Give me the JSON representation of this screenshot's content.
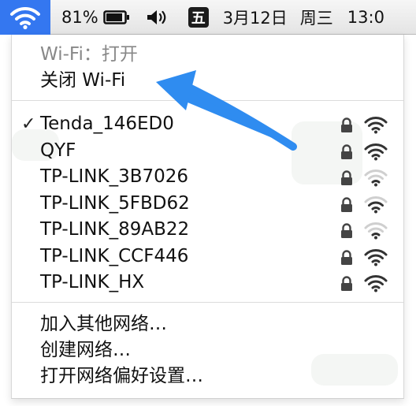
{
  "menubar": {
    "battery_percent": "81%",
    "ime_label": "五",
    "date": "3月12日",
    "weekday": "周三",
    "time": "13:0",
    "icons": [
      "wifi-icon",
      "battery-icon",
      "volume-icon",
      "ime-icon"
    ],
    "accent_color": "#3477f0"
  },
  "menu": {
    "status_text": "Wi-Fi：打开",
    "toggle_label": "关闭 Wi-Fi",
    "networks": [
      {
        "name": "Tenda_146ED0",
        "checked": true,
        "locked": true,
        "signal": 4
      },
      {
        "name": "QYF",
        "checked": false,
        "locked": true,
        "signal": 4
      },
      {
        "name": "TP-LINK_3B7026",
        "checked": false,
        "locked": true,
        "signal": 2
      },
      {
        "name": "TP-LINK_5FBD62",
        "checked": false,
        "locked": true,
        "signal": 3
      },
      {
        "name": "TP-LINK_89AB22",
        "checked": false,
        "locked": true,
        "signal": 2
      },
      {
        "name": "TP-LINK_CCF446",
        "checked": false,
        "locked": true,
        "signal": 4
      },
      {
        "name": "TP-LINK_HX",
        "checked": false,
        "locked": true,
        "signal": 4
      }
    ],
    "checkmark": "✓",
    "join_other": "加入其他网络…",
    "create_network": "创建网络…",
    "open_preferences": "打开网络偏好设置…"
  },
  "annotation": {
    "arrow_color": "#2f8cf0",
    "arrow_target": "关闭 Wi-Fi"
  }
}
